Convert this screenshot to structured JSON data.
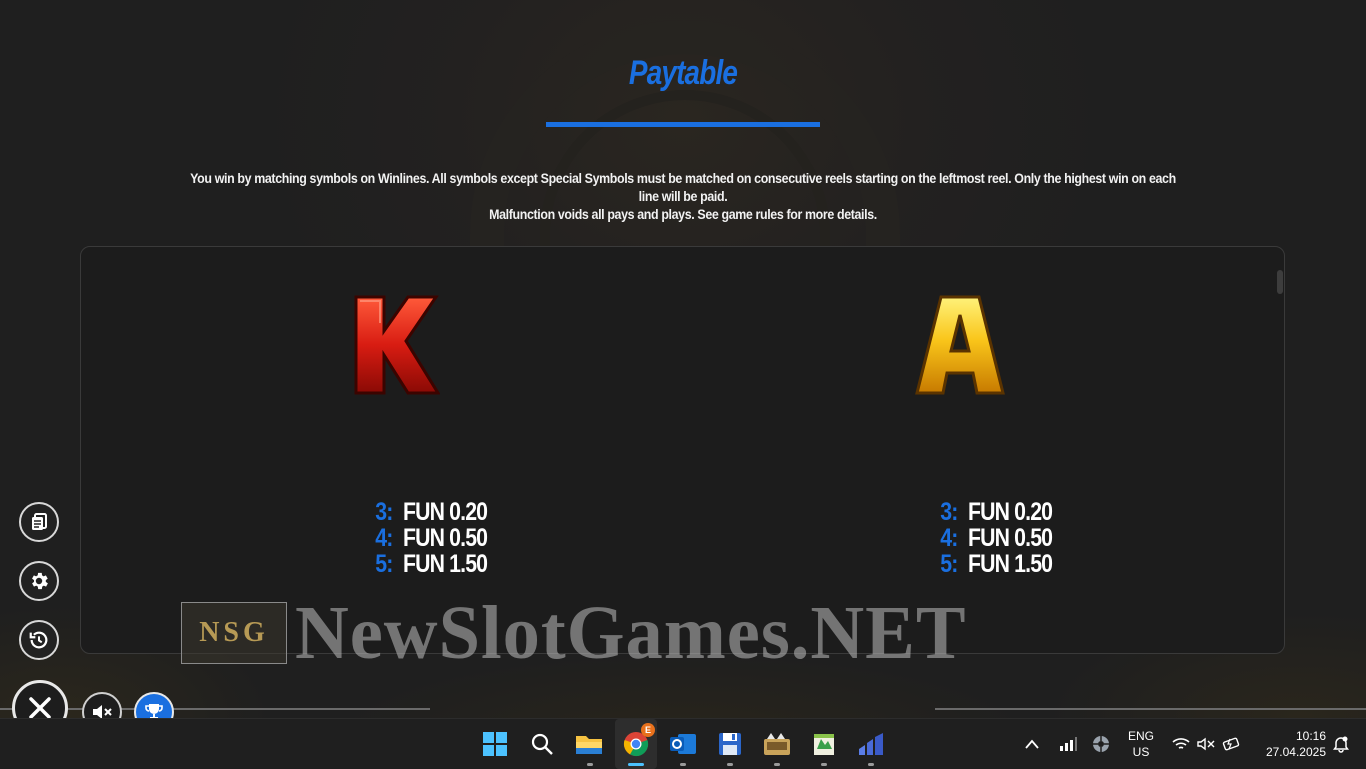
{
  "header": {
    "title": "Paytable"
  },
  "intro": {
    "line1": "You win by matching symbols on Winlines. All symbols except Special Symbols must be matched on consecutive reels starting on the leftmost reel. Only the highest win on each line will be paid.",
    "line2": "Malfunction voids all pays and plays. See game rules for more details."
  },
  "symbols": [
    {
      "glyph": "K",
      "pays": [
        {
          "count": "3:",
          "value": "FUN 0.20"
        },
        {
          "count": "4:",
          "value": "FUN 0.50"
        },
        {
          "count": "5:",
          "value": "FUN 1.50"
        }
      ],
      "color": "#d81c12"
    },
    {
      "glyph": "A",
      "pays": [
        {
          "count": "3:",
          "value": "FUN 0.20"
        },
        {
          "count": "4:",
          "value": "FUN 0.50"
        },
        {
          "count": "5:",
          "value": "FUN 1.50"
        }
      ],
      "color": "#f2b20a"
    }
  ],
  "side_buttons": [
    "paytable-icon",
    "settings-icon",
    "history-icon"
  ],
  "bottom_controls": [
    "close-icon",
    "sound-muted-icon",
    "trophy-icon"
  ],
  "watermark": {
    "logo_text": "NSG",
    "text": "NewSlotGames.NET"
  },
  "taskbar": {
    "apps": [
      "windows-start-icon",
      "search-icon",
      "file-explorer-icon",
      "chrome-icon",
      "outlook-icon",
      "save-disk-icon",
      "game-icon",
      "notepad-app-icon",
      "chart-app-icon"
    ],
    "chrome_badge": "E",
    "tray": {
      "language": "ENG",
      "region": "US",
      "time": "10:16",
      "date": "27.04.2025"
    }
  },
  "colors": {
    "accent": "#1a6fe0",
    "background": "#1e1e1e"
  }
}
